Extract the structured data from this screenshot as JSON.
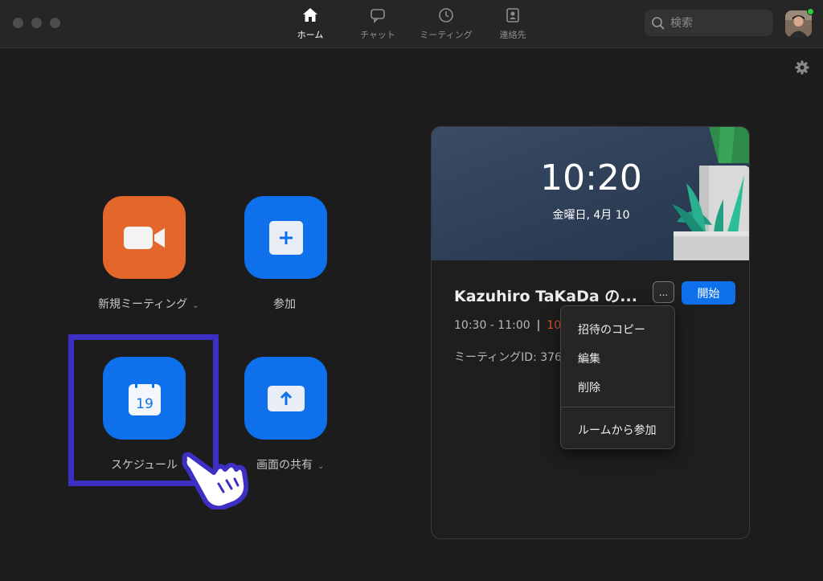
{
  "titlebar": {
    "tabs": [
      {
        "label": "ホーム",
        "icon": "home-icon",
        "active": true
      },
      {
        "label": "チャット",
        "icon": "chat-icon",
        "active": false
      },
      {
        "label": "ミーティング",
        "icon": "clock-icon",
        "active": false
      },
      {
        "label": "連絡先",
        "icon": "contacts-icon",
        "active": false
      }
    ],
    "search": {
      "placeholder": "検索"
    }
  },
  "actions": {
    "new_meeting": {
      "label": "新規ミーティング",
      "icon": "video-camera-icon"
    },
    "join": {
      "label": "参加",
      "icon": "plus-icon"
    },
    "schedule": {
      "label": "スケジュール",
      "icon": "calendar-icon",
      "calendar_day": "19"
    },
    "share_screen": {
      "label": "画面の共有",
      "icon": "arrow-up-icon"
    }
  },
  "panel": {
    "clock": "10:20",
    "date": "金曜日, 4月 10",
    "meeting": {
      "title": "Kazuhiro TaKaDa の...",
      "time": "10:30 - 11:00",
      "separator": "|",
      "countdown": "10",
      "meeting_id": "ミーティングID: 376"
    },
    "more_label": "...",
    "start_label": "開始"
  },
  "menu": {
    "items": [
      "招待のコピー",
      "編集",
      "削除",
      "ルームから参加"
    ]
  },
  "colors": {
    "accent_blue": "#0e71eb",
    "accent_orange": "#e3662a",
    "highlight": "#3d2fc4",
    "countdown_red": "#e4572e"
  }
}
